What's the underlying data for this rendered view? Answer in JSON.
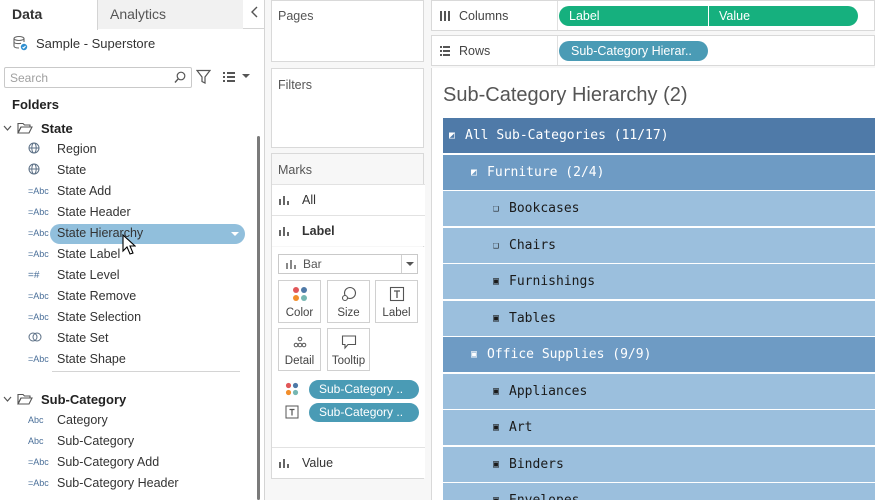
{
  "data_pane": {
    "tabs": [
      "Data",
      "Analytics"
    ],
    "datasource": "Sample - Superstore",
    "search_placeholder": "Search",
    "folders_label": "Folders",
    "folders": [
      {
        "name": "State",
        "fields": [
          {
            "icon": "globe",
            "label": "Region"
          },
          {
            "icon": "globe",
            "label": "State"
          },
          {
            "icon": "abc-calc",
            "label": "State Add"
          },
          {
            "icon": "abc-calc",
            "label": "State Header"
          },
          {
            "icon": "abc-calc",
            "label": "State Hierarchy",
            "selected": true
          },
          {
            "icon": "abc-calc",
            "label": "State Label"
          },
          {
            "icon": "hash-calc",
            "label": "State Level"
          },
          {
            "icon": "abc-calc",
            "label": "State Remove"
          },
          {
            "icon": "abc-calc",
            "label": "State Selection"
          },
          {
            "icon": "set",
            "label": "State Set"
          },
          {
            "icon": "abc-calc",
            "label": "State Shape"
          }
        ]
      },
      {
        "name": "Sub-Category",
        "fields": [
          {
            "icon": "abc",
            "label": "Category"
          },
          {
            "icon": "abc",
            "label": "Sub-Category"
          },
          {
            "icon": "abc-calc",
            "label": "Sub-Category Add"
          },
          {
            "icon": "abc-calc",
            "label": "Sub-Category Header"
          }
        ]
      }
    ]
  },
  "cards": {
    "pages": "Pages",
    "filters": "Filters",
    "marks": {
      "title": "Marks",
      "rows": [
        "All",
        "Label"
      ],
      "mark_type": "Bar",
      "buttons": [
        "Color",
        "Size",
        "Label",
        "Detail",
        "Tooltip"
      ],
      "pills": [
        "Sub-Category ..",
        "Sub-Category .."
      ],
      "value_row": "Value"
    }
  },
  "shelves": {
    "columns_label": "Columns",
    "columns_pills": [
      "Label",
      "Value"
    ],
    "rows_label": "Rows",
    "rows_pill": "Sub-Category Hierar.."
  },
  "view": {
    "title": "Sub-Category Hierarchy (2)",
    "rows": [
      {
        "level": 0,
        "marker": "◩",
        "text": "All Sub-Categories (11/17)"
      },
      {
        "level": 1,
        "marker": "◩",
        "text": "Furniture (2/4)"
      },
      {
        "level": 2,
        "marker": "❑",
        "text": "Bookcases"
      },
      {
        "level": 2,
        "marker": "❑",
        "text": "Chairs"
      },
      {
        "level": 2,
        "marker": "▣",
        "text": "Furnishings"
      },
      {
        "level": 2,
        "marker": "▣",
        "text": "Tables"
      },
      {
        "level": 1,
        "marker": "▣",
        "text": "Office Supplies (9/9)"
      },
      {
        "level": 2,
        "marker": "▣",
        "text": "Appliances"
      },
      {
        "level": 2,
        "marker": "▣",
        "text": "Art"
      },
      {
        "level": 2,
        "marker": "▣",
        "text": "Binders"
      },
      {
        "level": 2,
        "marker": "▣",
        "text": "Envelopes"
      }
    ]
  },
  "colors": {
    "dimension_pill": "#4a9bb5",
    "measure_pill": "#16b07e",
    "selected_field": "#91bfdc",
    "level0": "#4f7aa8",
    "level1": "#6e9bc4",
    "level2": "#9bbfdd"
  }
}
